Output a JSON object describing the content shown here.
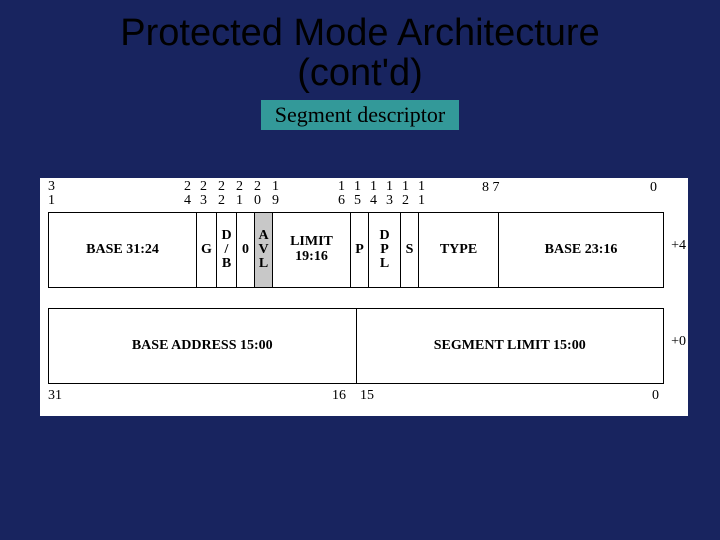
{
  "title_line1": "Protected Mode Architecture",
  "title_line2": "(cont'd)",
  "subtitle": "Segment descriptor",
  "top_bits": {
    "c31": "3\n1",
    "c24": "2\n4",
    "c23": "2\n3",
    "c22": "2\n2",
    "c21": "2\n1",
    "c20": "2\n0",
    "c19": "1\n9",
    "c16": "1\n6",
    "c15": "1\n5",
    "c14": "1\n4",
    "c13": "1\n3",
    "c12": "1\n2",
    "c11": "1\n1",
    "c87": "8 7",
    "c0": "0"
  },
  "row4": {
    "base_hi": "BASE 31:24",
    "g": "G",
    "db": "D\n/\nB",
    "zero": "0",
    "avl": "A\nV\nL",
    "limit_hi": "LIMIT\n19:16",
    "p": "P",
    "dpl": "D\nP\nL",
    "s": "S",
    "type": "TYPE",
    "base_mid": "BASE 23:16",
    "offset": "+4"
  },
  "row0": {
    "base_lo": "BASE ADDRESS 15:00",
    "limit_lo": "SEGMENT LIMIT 15:00",
    "offset": "+0"
  },
  "bot_bits": {
    "b31": "31",
    "b16": "16",
    "b15": "15",
    "b0": "0"
  }
}
